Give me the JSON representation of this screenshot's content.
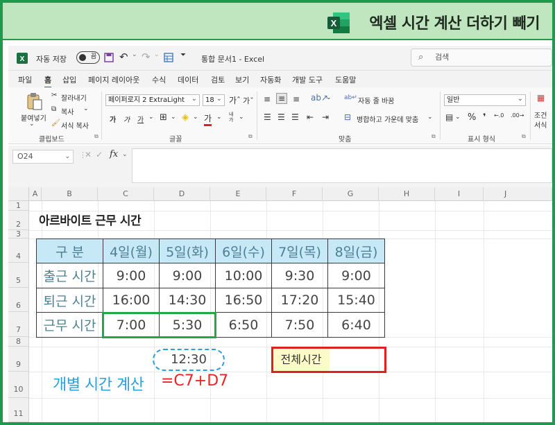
{
  "banner": {
    "title": "엑셀 시간 계산 더하기 빼기",
    "logo_letter": "X"
  },
  "titlebar": {
    "autosave_label": "자동 저장",
    "autosave_state": "끔",
    "doc_title": "통합 문서1  -  Excel",
    "search_placeholder": "검색"
  },
  "menu": [
    "파일",
    "홈",
    "삽입",
    "페이지 레이아웃",
    "수식",
    "데이터",
    "검토",
    "보기",
    "자동화",
    "개발 도구",
    "도움말"
  ],
  "ribbon": {
    "clipboard": {
      "paste": "붙여넣기",
      "cut": "잘라내기",
      "copy": "복사",
      "format_painter": "서식 복사",
      "group": "클립보드"
    },
    "font": {
      "name": "페이퍼로지 2 ExtraLight",
      "size": "18",
      "group": "글꼴"
    },
    "alignment": {
      "wrap": "자동 줄 바꿈",
      "merge": "병합하고 가운데 맞춤",
      "group": "맞춤"
    },
    "number": {
      "format": "일반",
      "group": "표시 형식"
    },
    "styles": {
      "cond": "조건",
      "fmt": "서식"
    }
  },
  "formula_bar": {
    "cell_ref": "O24",
    "fx": "fx"
  },
  "columns": [
    "A",
    "B",
    "C",
    "D",
    "E",
    "F",
    "G",
    "H",
    "I",
    "J"
  ],
  "rows": [
    "1",
    "2",
    "3",
    "4",
    "5",
    "6",
    "7",
    "8",
    "9",
    "10",
    "11"
  ],
  "sheet": {
    "title": "아르바이트 근무 시간",
    "header": [
      "구    분",
      "4일(월)",
      "5일(화)",
      "6일(수)",
      "7일(목)",
      "8일(금)"
    ],
    "rows": [
      {
        "label": "출근 시간",
        "values": [
          "9:00",
          "9:00",
          "10:00",
          "9:30",
          "9:00"
        ]
      },
      {
        "label": "퇴근 시간",
        "values": [
          "16:00",
          "14:30",
          "16:50",
          "17:20",
          "15:40"
        ]
      },
      {
        "label": "근무 시간",
        "values": [
          "7:00",
          "5:30",
          "6:50",
          "7:50",
          "6:40"
        ]
      }
    ],
    "sum_value": "12:30",
    "total_label": "전체시간",
    "total_value": "",
    "calc_label": "개별 시간 계산",
    "calc_formula": "=C7+D7"
  }
}
